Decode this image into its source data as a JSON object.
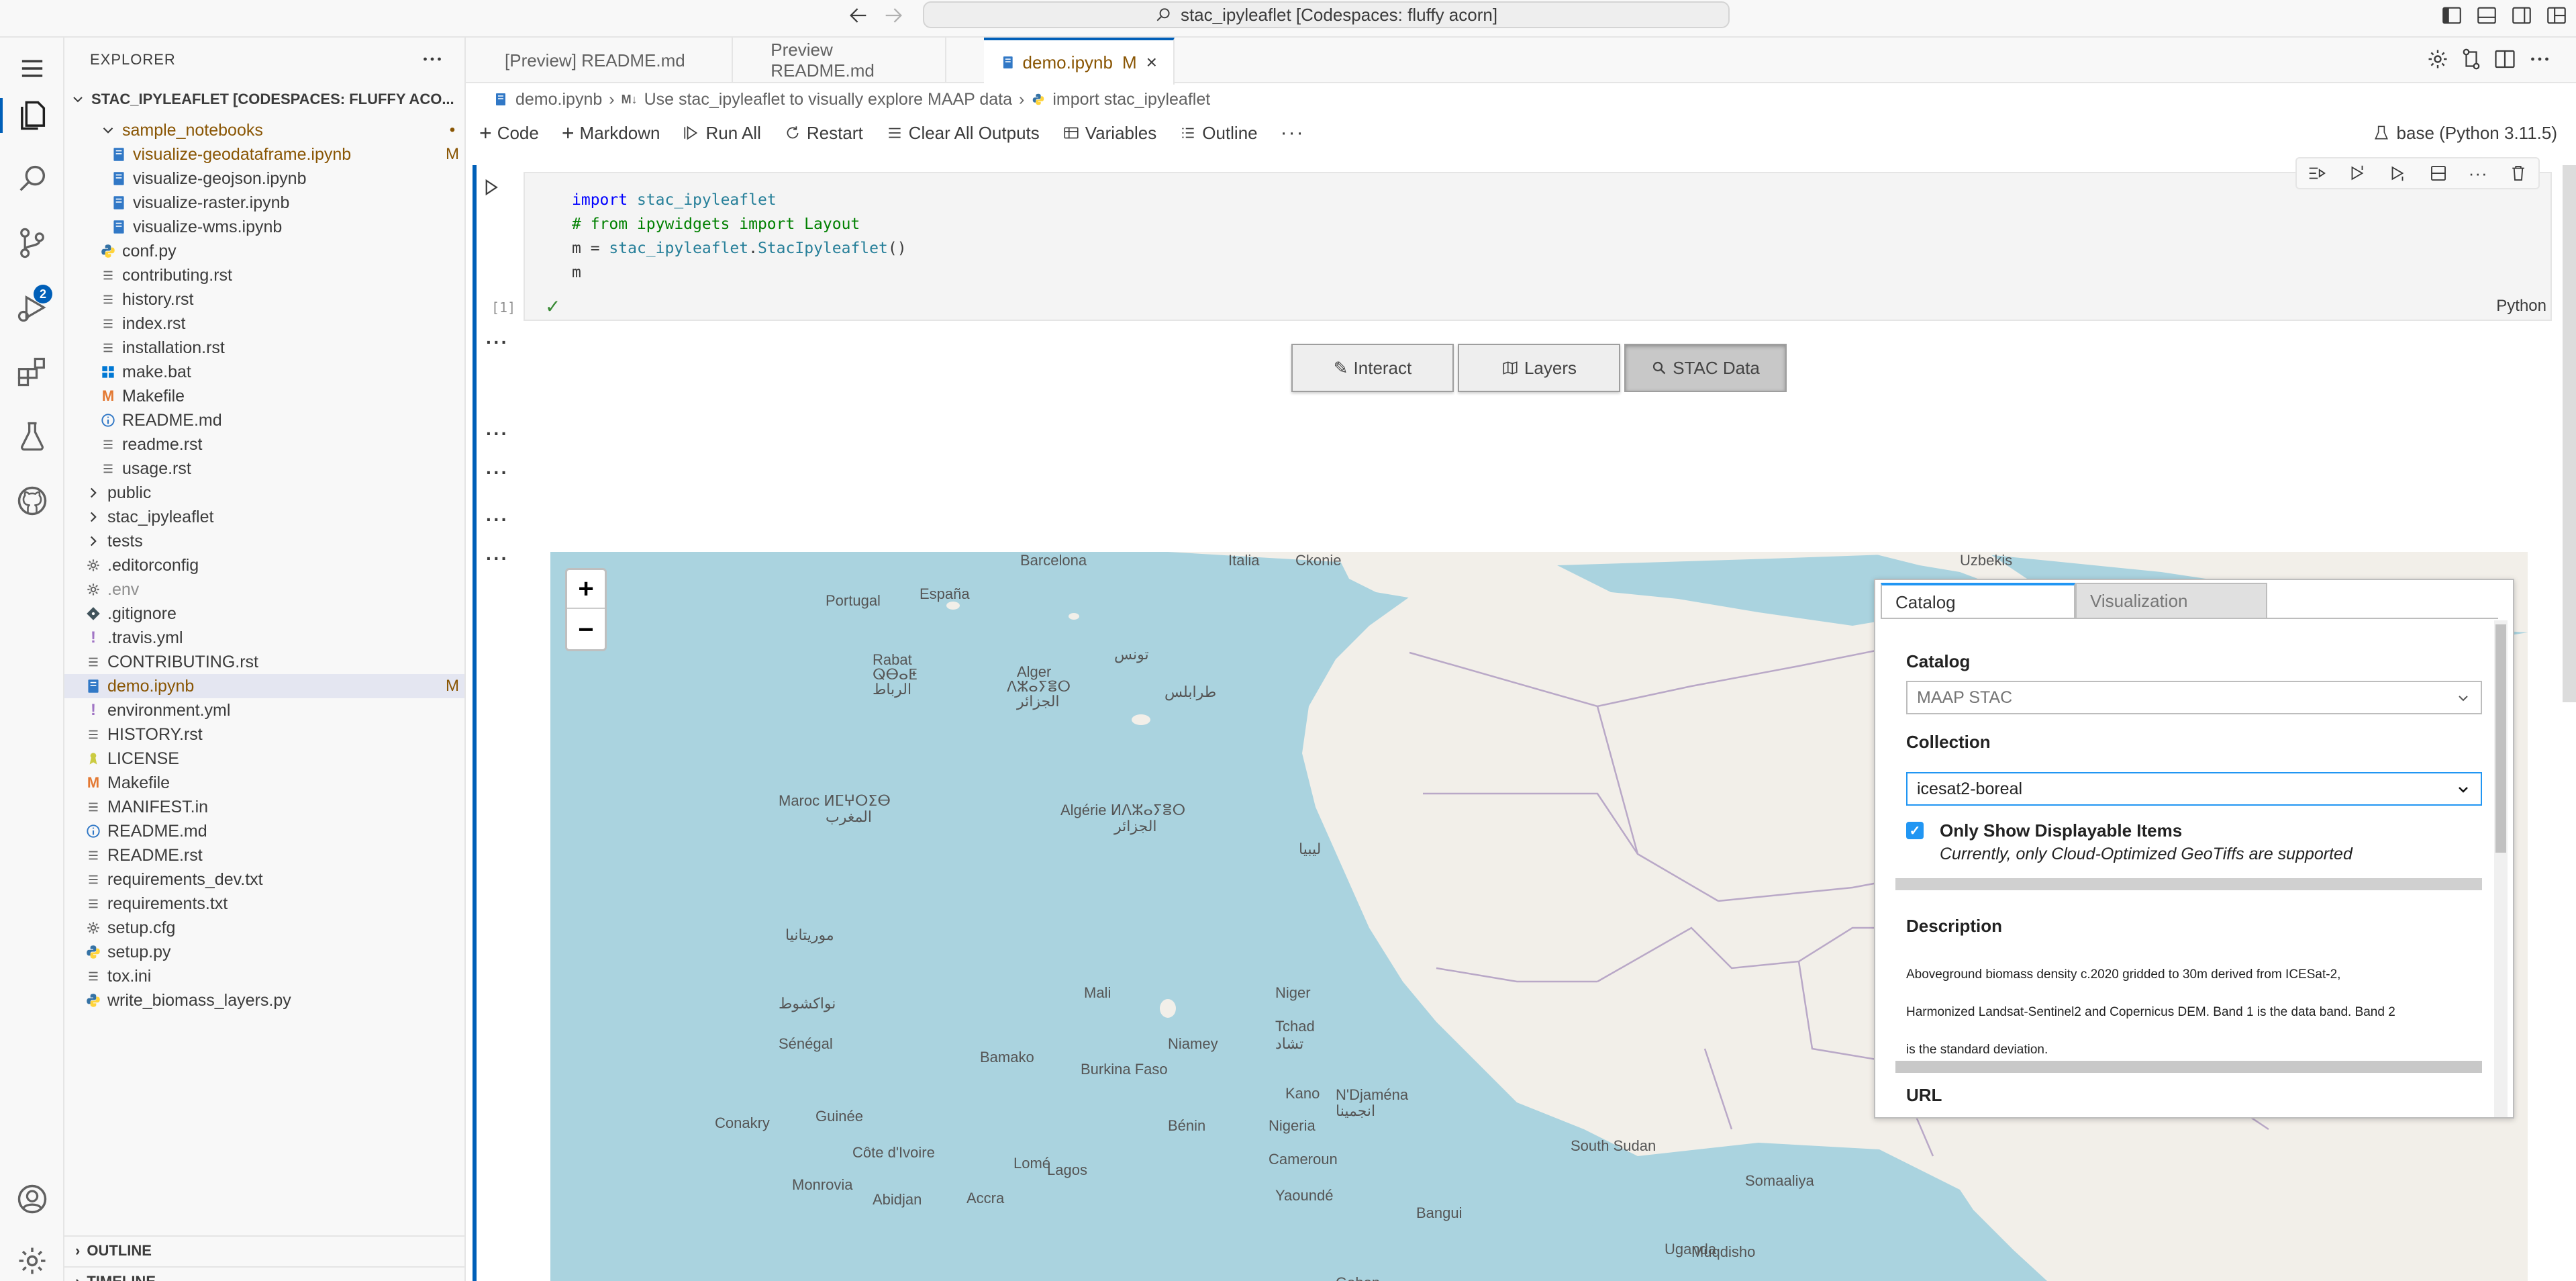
{
  "titlebar": {
    "search_text": "stac_ipyleaflet [Codespaces: fluffy acorn]"
  },
  "activity": {
    "scm_badge": "2"
  },
  "sidebar": {
    "title": "EXPLORER",
    "root": "STAC_IPYLEAFLET [CODESPACES: FLUFFY ACO...",
    "rows": [
      {
        "label": "sample_notebooks",
        "indent": 1,
        "icon": "chevron-down",
        "badge": "•",
        "state": "modified"
      },
      {
        "label": "visualize-geodataframe.ipynb",
        "indent": 2,
        "icon": "notebook",
        "badge": "M",
        "state": "modified"
      },
      {
        "label": "visualize-geojson.ipynb",
        "indent": 2,
        "icon": "notebook",
        "badge": "",
        "state": ""
      },
      {
        "label": "visualize-raster.ipynb",
        "indent": 2,
        "icon": "notebook",
        "badge": "",
        "state": ""
      },
      {
        "label": "visualize-wms.ipynb",
        "indent": 2,
        "icon": "notebook",
        "badge": "",
        "state": ""
      },
      {
        "label": "conf.py",
        "indent": 1,
        "icon": "python",
        "badge": "",
        "state": ""
      },
      {
        "label": "contributing.rst",
        "indent": 1,
        "icon": "lines",
        "badge": "",
        "state": ""
      },
      {
        "label": "history.rst",
        "indent": 1,
        "icon": "lines",
        "badge": "",
        "state": ""
      },
      {
        "label": "index.rst",
        "indent": 1,
        "icon": "lines",
        "badge": "",
        "state": ""
      },
      {
        "label": "installation.rst",
        "indent": 1,
        "icon": "lines",
        "badge": "",
        "state": ""
      },
      {
        "label": "make.bat",
        "indent": 1,
        "icon": "windows",
        "badge": "",
        "state": ""
      },
      {
        "label": "Makefile",
        "indent": 1,
        "icon": "makefile",
        "badge": "",
        "state": ""
      },
      {
        "label": "README.md",
        "indent": 1,
        "icon": "info",
        "badge": "",
        "state": ""
      },
      {
        "label": "readme.rst",
        "indent": 1,
        "icon": "lines",
        "badge": "",
        "state": ""
      },
      {
        "label": "usage.rst",
        "indent": 1,
        "icon": "lines",
        "badge": "",
        "state": ""
      },
      {
        "label": "public",
        "indent": 0,
        "icon": "chevron-right",
        "badge": "",
        "state": ""
      },
      {
        "label": "stac_ipyleaflet",
        "indent": 0,
        "icon": "chevron-right",
        "badge": "",
        "state": ""
      },
      {
        "label": "tests",
        "indent": 0,
        "icon": "chevron-right",
        "badge": "",
        "state": ""
      },
      {
        "label": ".editorconfig",
        "indent": 0,
        "icon": "gear",
        "badge": "",
        "state": ""
      },
      {
        "label": ".env",
        "indent": 0,
        "icon": "gear",
        "badge": "",
        "state": "dim"
      },
      {
        "label": ".gitignore",
        "indent": 0,
        "icon": "git",
        "badge": "",
        "state": ""
      },
      {
        "label": ".travis.yml",
        "indent": 0,
        "icon": "exclaim",
        "badge": "",
        "state": ""
      },
      {
        "label": "CONTRIBUTING.rst",
        "indent": 0,
        "icon": "lines",
        "badge": "",
        "state": ""
      },
      {
        "label": "demo.ipynb",
        "indent": 0,
        "icon": "notebook",
        "badge": "M",
        "state": "modified-selected"
      },
      {
        "label": "environment.yml",
        "indent": 0,
        "icon": "exclaim",
        "badge": "",
        "state": ""
      },
      {
        "label": "HISTORY.rst",
        "indent": 0,
        "icon": "lines",
        "badge": "",
        "state": ""
      },
      {
        "label": "LICENSE",
        "indent": 0,
        "icon": "license",
        "badge": "",
        "state": ""
      },
      {
        "label": "Makefile",
        "indent": 0,
        "icon": "makefile",
        "badge": "",
        "state": ""
      },
      {
        "label": "MANIFEST.in",
        "indent": 0,
        "icon": "lines",
        "badge": "",
        "state": ""
      },
      {
        "label": "README.md",
        "indent": 0,
        "icon": "info",
        "badge": "",
        "state": ""
      },
      {
        "label": "README.rst",
        "indent": 0,
        "icon": "lines",
        "badge": "",
        "state": ""
      },
      {
        "label": "requirements_dev.txt",
        "indent": 0,
        "icon": "lines",
        "badge": "",
        "state": ""
      },
      {
        "label": "requirements.txt",
        "indent": 0,
        "icon": "lines",
        "badge": "",
        "state": ""
      },
      {
        "label": "setup.cfg",
        "indent": 0,
        "icon": "gear",
        "badge": "",
        "state": ""
      },
      {
        "label": "setup.py",
        "indent": 0,
        "icon": "python",
        "badge": "",
        "state": ""
      },
      {
        "label": "tox.ini",
        "indent": 0,
        "icon": "lines",
        "badge": "",
        "state": ""
      },
      {
        "label": "write_biomass_layers.py",
        "indent": 0,
        "icon": "python",
        "badge": "",
        "state": ""
      }
    ],
    "outline": "OUTLINE",
    "timeline": "TIMELINE"
  },
  "tabs": [
    {
      "label": "[Preview] README.md",
      "active": false,
      "mark": ""
    },
    {
      "label": "Preview README.md",
      "active": false,
      "mark": ""
    },
    {
      "label": "demo.ipynb",
      "active": true,
      "mark": "M"
    }
  ],
  "breadcrumb": {
    "file": "demo.ipynb",
    "section": "Use stac_ipyleaflet to visually explore MAAP data",
    "cell": "import stac_ipyleaflet"
  },
  "nbtoolbar": {
    "code": "Code",
    "markdown": "Markdown",
    "run_all": "Run All",
    "restart": "Restart",
    "clear": "Clear All Outputs",
    "variables": "Variables",
    "outline": "Outline",
    "kernel": "base (Python 3.11.5)"
  },
  "cell": {
    "lines": [
      "import stac_ipyleaflet",
      "# from ipywidgets import Layout",
      "m = stac_ipyleaflet.StacIpyleaflet()",
      "m"
    ],
    "exec_count": "[1]",
    "language": "Python"
  },
  "output": {
    "buttons": [
      {
        "label": "Interact",
        "icon": "pencil",
        "active": false
      },
      {
        "label": "Layers",
        "icon": "map",
        "active": false
      },
      {
        "label": "STAC Data",
        "icon": "search",
        "active": true
      }
    ]
  },
  "map": {
    "labels": [
      {
        "text": "Barcelona"
      },
      {
        "text": "Italia"
      },
      {
        "text": "Portugal"
      },
      {
        "text": "España"
      },
      {
        "text": "Rabat"
      },
      {
        "text": "ⵕⴱⴰⵟ"
      },
      {
        "text": "الرباط"
      },
      {
        "text": "Alger"
      },
      {
        "text": "ⴷⵣⴰⵢⴻⵔ"
      },
      {
        "text": "الجزائر"
      },
      {
        "text": "تونس"
      },
      {
        "text": "طرابلس"
      },
      {
        "text": "Maroc ⵍⵎⵖⵔⵉⴱ"
      },
      {
        "text": "المغرب"
      },
      {
        "text": "Algérie ⵍⴷⵣⴰⵢⴻⵔ"
      },
      {
        "text": "الجزائر"
      },
      {
        "text": "ليبيا"
      },
      {
        "text": "موريتانيا"
      },
      {
        "text": "Mali"
      },
      {
        "text": "Niger"
      },
      {
        "text": "نواكشوط"
      },
      {
        "text": "Sénégal"
      },
      {
        "text": "Bamako"
      },
      {
        "text": "Niamey"
      },
      {
        "text": "Burkina Faso"
      },
      {
        "text": "Tchad"
      },
      {
        "text": "تشاد"
      },
      {
        "text": "Kano"
      },
      {
        "text": "N'Djaména"
      },
      {
        "text": "انجمينا"
      },
      {
        "text": "Conakry"
      },
      {
        "text": "Guinée"
      },
      {
        "text": "Bénin"
      },
      {
        "text": "Nigeria"
      },
      {
        "text": "Côte d'Ivoire"
      },
      {
        "text": "Lomé"
      },
      {
        "text": "Lagos"
      },
      {
        "text": "Cameroun"
      },
      {
        "text": "South Sudan"
      },
      {
        "text": "Monrovia"
      },
      {
        "text": "Abidjan"
      },
      {
        "text": "Accra"
      },
      {
        "text": "Yaoundé"
      },
      {
        "text": "Bangui"
      },
      {
        "text": "Uganda"
      },
      {
        "text": "Somaaliya"
      },
      {
        "text": "Muqdisho"
      },
      {
        "text": "Gabon"
      },
      {
        "text": "Uzbekis"
      },
      {
        "text": "Ckonie"
      }
    ],
    "zoom_in": "+",
    "zoom_out": "−"
  },
  "stac_panel": {
    "tab_catalog": "Catalog",
    "tab_visualization": "Visualization",
    "catalog_label": "Catalog",
    "catalog_value": "MAAP STAC",
    "collection_label": "Collection",
    "collection_value": "icesat2-boreal",
    "checkbox_label": "Only Show Displayable Items",
    "checkbox_checked": true,
    "checkbox_hint": "Currently, only Cloud-Optimized GeoTiffs are supported",
    "description_label": "Description",
    "description_lines": [
      "Aboveground biomass density c.2020 gridded to 30m derived from ICESat-2,",
      "Harmonized Landsat-Sentinel2 and Copernicus DEM. Band 1 is the data band. Band 2",
      "is the standard deviation."
    ],
    "url_label": "URL"
  },
  "colors": {
    "accent": "#005fb8",
    "modified": "#895503",
    "sea": "#aad3df",
    "land": "#f2efe9",
    "panel_accent": "#2196f3"
  }
}
